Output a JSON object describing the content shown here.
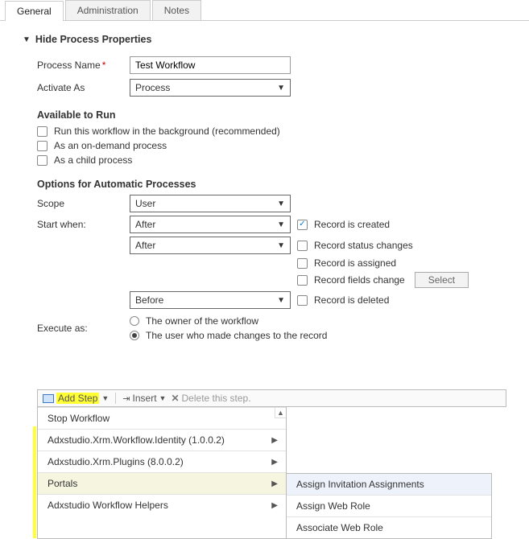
{
  "tabs": {
    "general": "General",
    "admin": "Administration",
    "notes": "Notes"
  },
  "collapse_label": "Hide Process Properties",
  "fields": {
    "process_name_label": "Process Name",
    "process_name_value": "Test Workflow",
    "activate_as_label": "Activate As",
    "activate_as_value": "Process"
  },
  "avail_header": "Available to Run",
  "avail": {
    "bg": "Run this workflow in the background (recommended)",
    "ondemand": "As an on-demand process",
    "child": "As a child process"
  },
  "auto_header": "Options for Automatic Processes",
  "scope_label": "Scope",
  "scope_value": "User",
  "start_when_label": "Start when:",
  "after_value": "After",
  "before_value": "Before",
  "triggers": {
    "created": "Record is created",
    "status": "Record status changes",
    "assigned": "Record is assigned",
    "fields": "Record fields change",
    "deleted": "Record is deleted"
  },
  "select_btn": "Select",
  "execute_label": "Execute as:",
  "execute_opts": {
    "owner": "The owner of the workflow",
    "user": "The user who made changes to the record"
  },
  "toolbar": {
    "add_step": "Add Step",
    "insert": "Insert",
    "delete": "Delete this step."
  },
  "menu1": {
    "stop": "Stop Workflow",
    "identity": "Adxstudio.Xrm.Workflow.Identity (1.0.0.2)",
    "plugins": "Adxstudio.Xrm.Plugins (8.0.0.2)",
    "portals": "Portals",
    "helpers": "Adxstudio Workflow Helpers"
  },
  "menu2": {
    "assign_inv": "Assign Invitation Assignments",
    "assign_role": "Assign Web Role",
    "assoc_role": "Associate Web Role"
  }
}
